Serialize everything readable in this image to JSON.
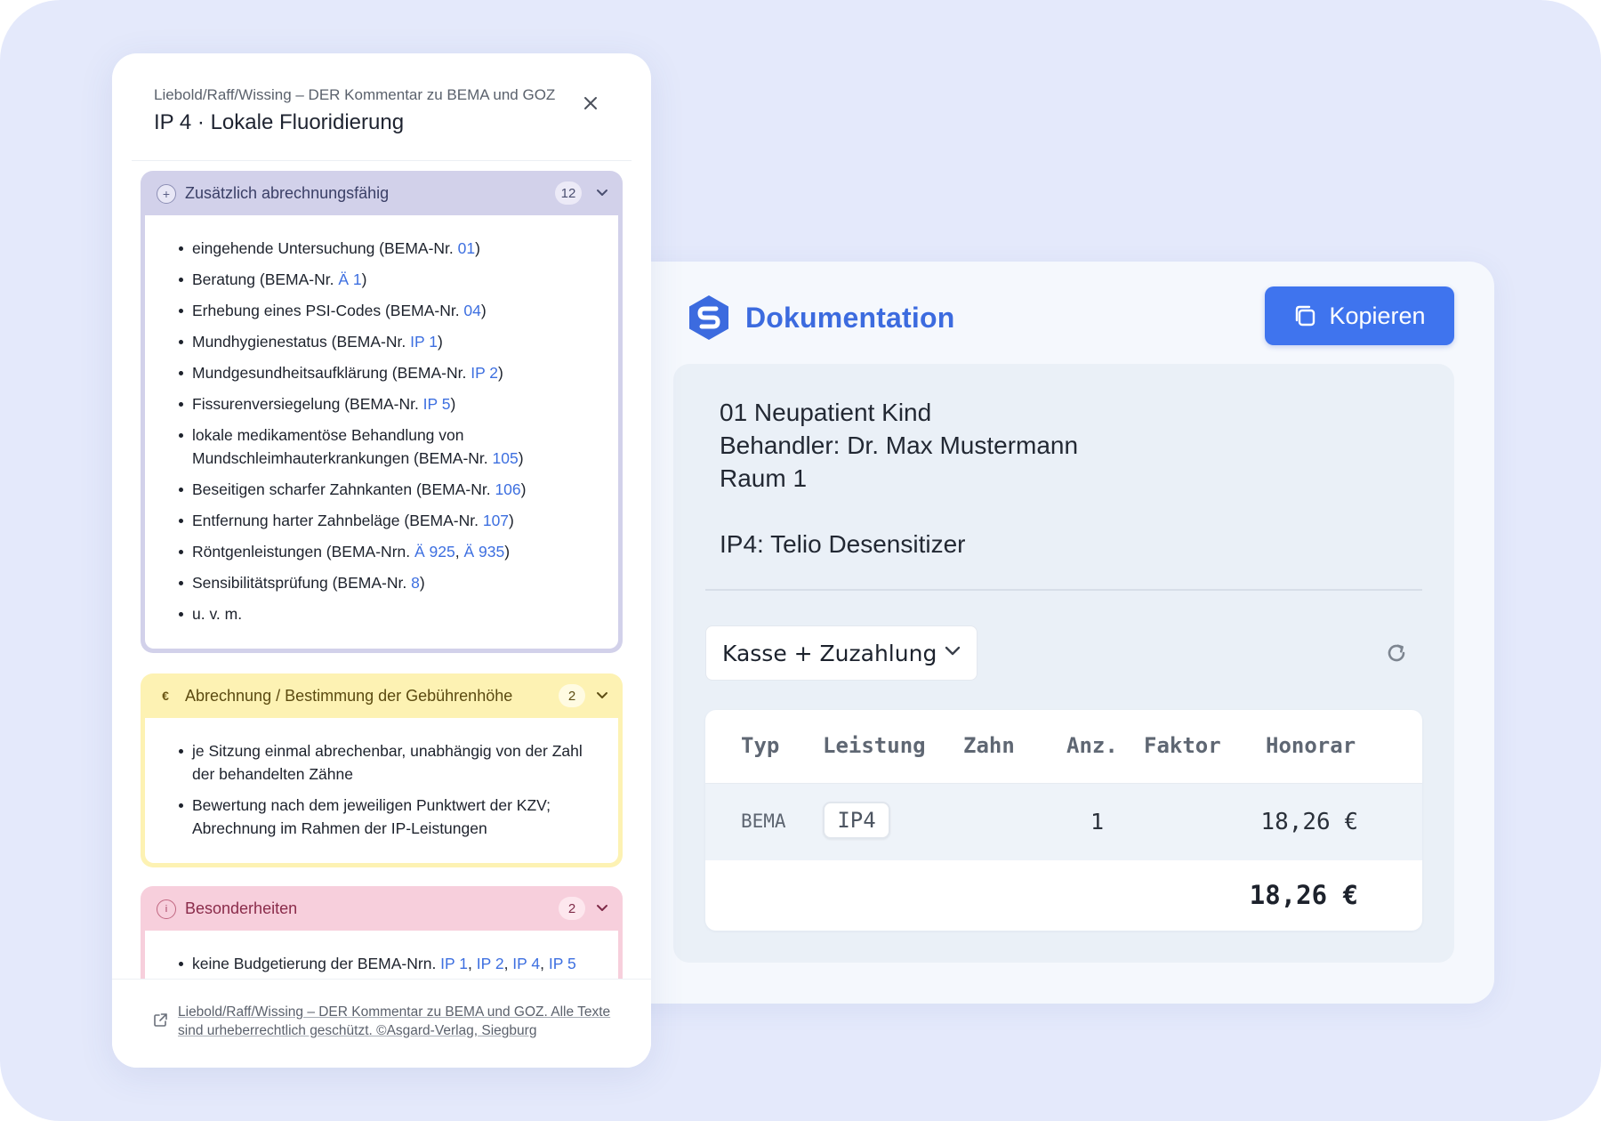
{
  "panel": {
    "subtitle": "Liebold/Raff/Wissing – DER Kommentar zu BEMA und GOZ",
    "title": "IP 4 · Lokale Fluoridierung",
    "sections": [
      {
        "label": "Zusätzlich abrechnungsfähig",
        "count": "12",
        "icon": "plus-icon",
        "items": [
          {
            "pre": "eingehende Untersuchung (BEMA-Nr. ",
            "links": [
              "01"
            ],
            "post": ")"
          },
          {
            "pre": "Beratung (BEMA-Nr. ",
            "links": [
              "Ä 1"
            ],
            "post": ")"
          },
          {
            "pre": "Erhebung eines PSI-Codes (BEMA-Nr. ",
            "links": [
              "04"
            ],
            "post": ")"
          },
          {
            "pre": "Mundhygienestatus (BEMA-Nr. ",
            "links": [
              "IP 1"
            ],
            "post": ")"
          },
          {
            "pre": "Mundgesundheitsaufklärung (BEMA-Nr. ",
            "links": [
              "IP 2"
            ],
            "post": ")"
          },
          {
            "pre": "Fissurenversiegelung (BEMA-Nr. ",
            "links": [
              "IP 5"
            ],
            "post": ")"
          },
          {
            "pre": "lokale medikamentöse Behandlung von Mundschleimhauterkrankungen (BEMA-Nr. ",
            "links": [
              "105"
            ],
            "post": ")"
          },
          {
            "pre": "Beseitigen scharfer Zahnkanten (BEMA-Nr. ",
            "links": [
              "106"
            ],
            "post": ")"
          },
          {
            "pre": "Entfernung harter Zahnbeläge (BEMA-Nr. ",
            "links": [
              "107"
            ],
            "post": ")"
          },
          {
            "pre": "Röntgenleistungen (BEMA-Nrn. ",
            "links": [
              "Ä 925",
              "Ä 935"
            ],
            "post": ")"
          },
          {
            "pre": "Sensibilitätsprüfung (BEMA-Nr. ",
            "links": [
              "8"
            ],
            "post": ")"
          },
          {
            "pre": "u. v. m.",
            "links": [],
            "post": ""
          }
        ]
      },
      {
        "label": "Abrechnung / Bestimmung der Gebührenhöhe",
        "count": "2",
        "icon": "euro-icon",
        "items": [
          {
            "pre": "je Sitzung einmal abrechenbar, unabhängig von der Zahl der behandelten Zähne",
            "links": [],
            "post": ""
          },
          {
            "pre": "Bewertung nach dem jeweiligen Punktwert der KZV; Abrechnung im Rahmen der IP-Leistungen",
            "links": [],
            "post": ""
          }
        ]
      },
      {
        "label": "Besonderheiten",
        "count": "2",
        "icon": "info-icon",
        "items": [
          {
            "pre": "keine Budgetierung der BEMA-Nrn. ",
            "links": [
              "IP 1",
              "IP 2",
              "IP 4",
              "IP 5"
            ],
            "post": ""
          }
        ]
      }
    ],
    "footer": "Liebold/Raff/Wissing – DER Kommentar zu BEMA und GOZ. Alle Texte sind urheberrechtlich geschützt. ©Asgard-Verlag, Siegburg"
  },
  "doc": {
    "title": "Dokumentation",
    "copy_label": "Kopieren",
    "notes": [
      "01 Neupatient Kind",
      "Behandler: Dr. Max Mustermann",
      "Raum 1",
      "",
      "IP4: Telio Desensitizer"
    ],
    "select_value": "Kasse + Zuzahlung",
    "table": {
      "headers": [
        "Typ",
        "Leistung",
        "Zahn",
        "Anz.",
        "Faktor",
        "Honorar"
      ],
      "row": {
        "typ": "BEMA",
        "leistung": "IP4",
        "zahn": "",
        "anz": "1",
        "faktor": "",
        "honorar": "18,26 €"
      },
      "total": "18,26 €"
    }
  },
  "colors": {
    "accent": "#3f74ee",
    "section1": "#d2d1ea",
    "section2": "#fdf2b3",
    "section3": "#f7cfdc",
    "link": "#3d6fe0"
  }
}
